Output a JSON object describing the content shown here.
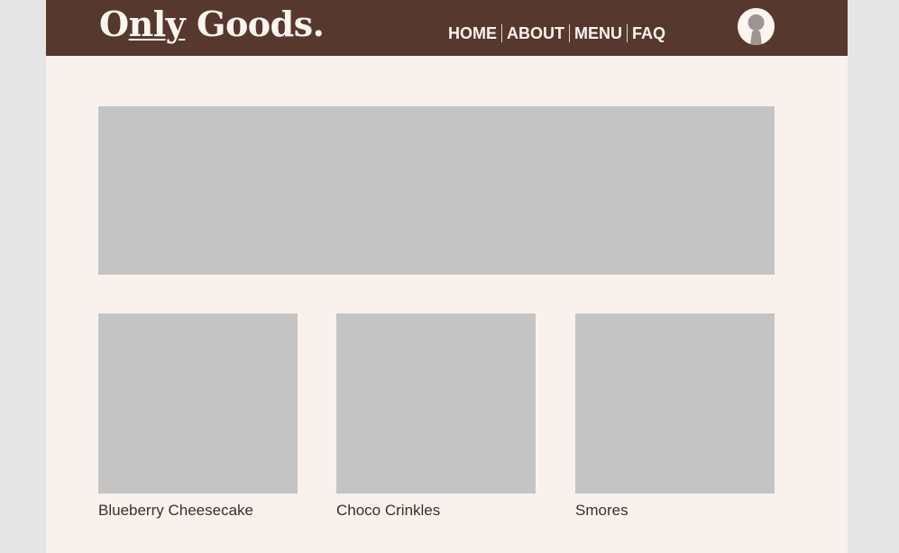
{
  "header": {
    "logo_prefix": "O",
    "logo_underlined": "nly",
    "logo_suffix": " Goods.",
    "nav": [
      "HOME",
      "ABOUT",
      "MENU",
      "FAQ"
    ],
    "avatar_icon": "user-avatar-icon"
  },
  "main": {
    "hero_banner_icon": "image-placeholder",
    "products": [
      {
        "name": "Blueberry Cheesecake"
      },
      {
        "name": "Choco Crinkles"
      },
      {
        "name": "Smores"
      }
    ]
  },
  "colors": {
    "header_bg": "#57382e",
    "page_bg": "#f9f2ec",
    "outer_bg": "#e5e5e5",
    "placeholder": "#c4c4c4",
    "header_text": "#fbf5ef"
  }
}
